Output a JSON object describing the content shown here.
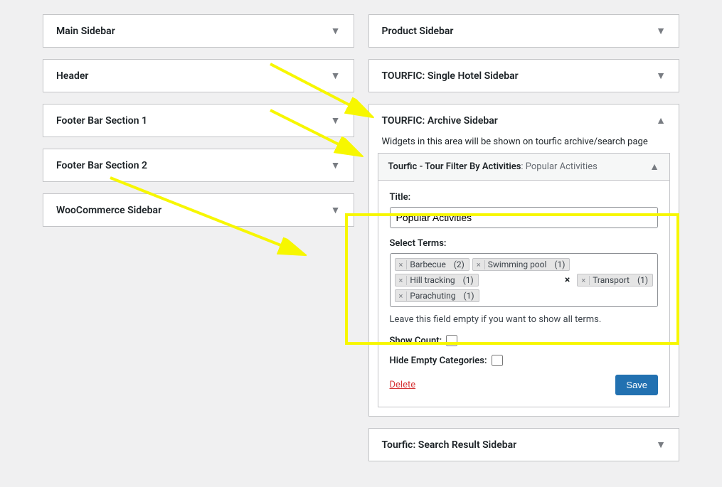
{
  "left_column": [
    {
      "title": "Main Sidebar"
    },
    {
      "title": "Header"
    },
    {
      "title": "Footer Bar Section 1"
    },
    {
      "title": "Footer Bar Section 2"
    },
    {
      "title": "WooCommerce Sidebar"
    }
  ],
  "right_column": {
    "product_sidebar": {
      "title": "Product Sidebar"
    },
    "single_hotel": {
      "title": "TOURFIC: Single Hotel Sidebar"
    },
    "archive": {
      "title": "TOURFIC: Archive Sidebar",
      "description": "Widgets in this area will be shown on tourfic archive/search page",
      "widget": {
        "title_main": "Tourfic - Tour Filter By Activities",
        "title_sub": ": Popular Activities",
        "form": {
          "title_label": "Title:",
          "title_value": "Popular Activities",
          "terms_label": "Select Terms:",
          "terms": [
            {
              "name": "Barbecue",
              "count": "(2)"
            },
            {
              "name": "Swimming pool",
              "count": "(1)"
            },
            {
              "name": "Hill tracking",
              "count": "(1)"
            },
            {
              "name": "Transport",
              "count": "(1)"
            },
            {
              "name": "Parachuting",
              "count": "(1)"
            }
          ],
          "helper_text": "Leave this field empty if you want to show all terms.",
          "show_count_label": "Show Count:",
          "hide_empty_label": "Hide Empty Categories:",
          "delete_label": "Delete",
          "save_label": "Save"
        }
      }
    },
    "search_result": {
      "title": "Tourfic: Search Result Sidebar"
    }
  }
}
